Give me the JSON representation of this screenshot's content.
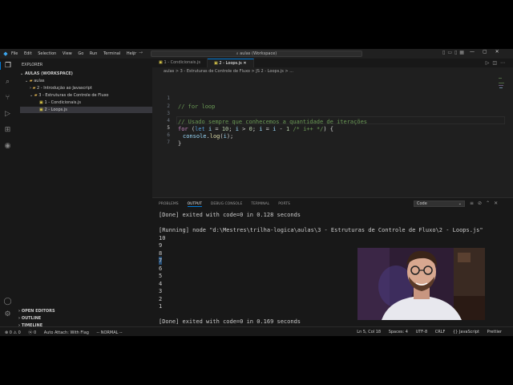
{
  "menu": [
    "File",
    "Edit",
    "Selection",
    "View",
    "Go",
    "Run",
    "Terminal",
    "Help"
  ],
  "search": {
    "text": "aulas (Workspace)"
  },
  "sidebar": {
    "title": "EXPLORER",
    "workspace": "AULAS (WORKSPACE)",
    "tree": [
      {
        "label": "aulas",
        "kind": "folder",
        "indent": 0
      },
      {
        "label": "2 - Introdução ao Javascript",
        "kind": "folder",
        "indent": 1
      },
      {
        "label": "3 - Estruturas de Controle de Fluxo",
        "kind": "folder",
        "indent": 1
      },
      {
        "label": "1 - Condicionais.js",
        "kind": "js",
        "indent": 2
      },
      {
        "label": "2 - Loops.js",
        "kind": "js",
        "indent": 2
      }
    ],
    "sections": [
      "OPEN EDITORS",
      "OUTLINE",
      "TIMELINE"
    ]
  },
  "tabs": [
    {
      "label": "1 - Condicionais.js",
      "active": false
    },
    {
      "label": "2 - Loops.js",
      "active": true
    }
  ],
  "breadcrumb": "aulas > 3 - Estruturas de Controle de Fluxo > JS 2 - Loops.js > ...",
  "code": {
    "line_numbers": [
      "1",
      "2",
      "3",
      "4",
      "5",
      "6",
      "7"
    ],
    "line1": "// for loop",
    "line3": "// Usado sempre que conhecemos a quantidade de iterações",
    "line4": {
      "kw_for": "for",
      "p1": " (",
      "kw_let": "let",
      "v1": " i",
      "p2": " = ",
      "n1": "10",
      "p3": "; ",
      "v2": "i",
      "p4": " > ",
      "n2": "0",
      "p5": "; ",
      "v3": "i",
      "p6": " = ",
      "v4": "i",
      "p7": " - ",
      "n3": "1",
      "p8": " ",
      "com": "/* i++ */",
      "p9": ") {"
    },
    "line5": {
      "obj": "console",
      "dot": ".",
      "fn": "log",
      "p1": "(",
      "v": "i",
      "p2": ");"
    },
    "line6": "}"
  },
  "panel": {
    "tabs": [
      "PROBLEMS",
      "OUTPUT",
      "DEBUG CONSOLE",
      "TERMINAL",
      "PORTS"
    ],
    "active_tab": "OUTPUT",
    "channel": "Code",
    "done1": "[Done] exited with code=0 in 0.128 seconds",
    "running": "[Running] node \"d:\\Mestres\\trilha-logica\\aulas\\3 - Estruturas de Controle de Fluxo\\2 - Loops.js\"",
    "numbers": [
      "10",
      "9",
      "8",
      "7",
      "6",
      "5",
      "4",
      "3",
      "2",
      "1"
    ],
    "done2": "[Done] exited with code=0 in 0.169 seconds"
  },
  "status": {
    "left": [
      "⊗ 0  ⚠ 0",
      "ⓦ 0",
      "Auto Attach: With Flag",
      "-- NORMAL --"
    ],
    "right": [
      "Ln 5, Col 18",
      "Spaces: 4",
      "UTF-8",
      "CRLF",
      "{} JavaScript",
      "Prettier"
    ]
  }
}
